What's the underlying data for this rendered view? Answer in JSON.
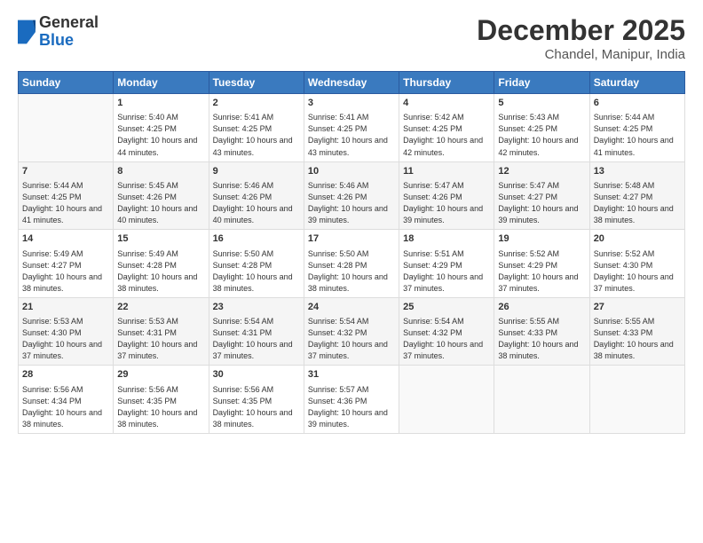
{
  "logo": {
    "general": "General",
    "blue": "Blue"
  },
  "title": "December 2025",
  "location": "Chandel, Manipur, India",
  "weekdays": [
    "Sunday",
    "Monday",
    "Tuesday",
    "Wednesday",
    "Thursday",
    "Friday",
    "Saturday"
  ],
  "weeks": [
    [
      {
        "day": "",
        "sunrise": "",
        "sunset": "",
        "daylight": ""
      },
      {
        "day": "1",
        "sunrise": "Sunrise: 5:40 AM",
        "sunset": "Sunset: 4:25 PM",
        "daylight": "Daylight: 10 hours and 44 minutes."
      },
      {
        "day": "2",
        "sunrise": "Sunrise: 5:41 AM",
        "sunset": "Sunset: 4:25 PM",
        "daylight": "Daylight: 10 hours and 43 minutes."
      },
      {
        "day": "3",
        "sunrise": "Sunrise: 5:41 AM",
        "sunset": "Sunset: 4:25 PM",
        "daylight": "Daylight: 10 hours and 43 minutes."
      },
      {
        "day": "4",
        "sunrise": "Sunrise: 5:42 AM",
        "sunset": "Sunset: 4:25 PM",
        "daylight": "Daylight: 10 hours and 42 minutes."
      },
      {
        "day": "5",
        "sunrise": "Sunrise: 5:43 AM",
        "sunset": "Sunset: 4:25 PM",
        "daylight": "Daylight: 10 hours and 42 minutes."
      },
      {
        "day": "6",
        "sunrise": "Sunrise: 5:44 AM",
        "sunset": "Sunset: 4:25 PM",
        "daylight": "Daylight: 10 hours and 41 minutes."
      }
    ],
    [
      {
        "day": "7",
        "sunrise": "Sunrise: 5:44 AM",
        "sunset": "Sunset: 4:25 PM",
        "daylight": "Daylight: 10 hours and 41 minutes."
      },
      {
        "day": "8",
        "sunrise": "Sunrise: 5:45 AM",
        "sunset": "Sunset: 4:26 PM",
        "daylight": "Daylight: 10 hours and 40 minutes."
      },
      {
        "day": "9",
        "sunrise": "Sunrise: 5:46 AM",
        "sunset": "Sunset: 4:26 PM",
        "daylight": "Daylight: 10 hours and 40 minutes."
      },
      {
        "day": "10",
        "sunrise": "Sunrise: 5:46 AM",
        "sunset": "Sunset: 4:26 PM",
        "daylight": "Daylight: 10 hours and 39 minutes."
      },
      {
        "day": "11",
        "sunrise": "Sunrise: 5:47 AM",
        "sunset": "Sunset: 4:26 PM",
        "daylight": "Daylight: 10 hours and 39 minutes."
      },
      {
        "day": "12",
        "sunrise": "Sunrise: 5:47 AM",
        "sunset": "Sunset: 4:27 PM",
        "daylight": "Daylight: 10 hours and 39 minutes."
      },
      {
        "day": "13",
        "sunrise": "Sunrise: 5:48 AM",
        "sunset": "Sunset: 4:27 PM",
        "daylight": "Daylight: 10 hours and 38 minutes."
      }
    ],
    [
      {
        "day": "14",
        "sunrise": "Sunrise: 5:49 AM",
        "sunset": "Sunset: 4:27 PM",
        "daylight": "Daylight: 10 hours and 38 minutes."
      },
      {
        "day": "15",
        "sunrise": "Sunrise: 5:49 AM",
        "sunset": "Sunset: 4:28 PM",
        "daylight": "Daylight: 10 hours and 38 minutes."
      },
      {
        "day": "16",
        "sunrise": "Sunrise: 5:50 AM",
        "sunset": "Sunset: 4:28 PM",
        "daylight": "Daylight: 10 hours and 38 minutes."
      },
      {
        "day": "17",
        "sunrise": "Sunrise: 5:50 AM",
        "sunset": "Sunset: 4:28 PM",
        "daylight": "Daylight: 10 hours and 38 minutes."
      },
      {
        "day": "18",
        "sunrise": "Sunrise: 5:51 AM",
        "sunset": "Sunset: 4:29 PM",
        "daylight": "Daylight: 10 hours and 37 minutes."
      },
      {
        "day": "19",
        "sunrise": "Sunrise: 5:52 AM",
        "sunset": "Sunset: 4:29 PM",
        "daylight": "Daylight: 10 hours and 37 minutes."
      },
      {
        "day": "20",
        "sunrise": "Sunrise: 5:52 AM",
        "sunset": "Sunset: 4:30 PM",
        "daylight": "Daylight: 10 hours and 37 minutes."
      }
    ],
    [
      {
        "day": "21",
        "sunrise": "Sunrise: 5:53 AM",
        "sunset": "Sunset: 4:30 PM",
        "daylight": "Daylight: 10 hours and 37 minutes."
      },
      {
        "day": "22",
        "sunrise": "Sunrise: 5:53 AM",
        "sunset": "Sunset: 4:31 PM",
        "daylight": "Daylight: 10 hours and 37 minutes."
      },
      {
        "day": "23",
        "sunrise": "Sunrise: 5:54 AM",
        "sunset": "Sunset: 4:31 PM",
        "daylight": "Daylight: 10 hours and 37 minutes."
      },
      {
        "day": "24",
        "sunrise": "Sunrise: 5:54 AM",
        "sunset": "Sunset: 4:32 PM",
        "daylight": "Daylight: 10 hours and 37 minutes."
      },
      {
        "day": "25",
        "sunrise": "Sunrise: 5:54 AM",
        "sunset": "Sunset: 4:32 PM",
        "daylight": "Daylight: 10 hours and 37 minutes."
      },
      {
        "day": "26",
        "sunrise": "Sunrise: 5:55 AM",
        "sunset": "Sunset: 4:33 PM",
        "daylight": "Daylight: 10 hours and 38 minutes."
      },
      {
        "day": "27",
        "sunrise": "Sunrise: 5:55 AM",
        "sunset": "Sunset: 4:33 PM",
        "daylight": "Daylight: 10 hours and 38 minutes."
      }
    ],
    [
      {
        "day": "28",
        "sunrise": "Sunrise: 5:56 AM",
        "sunset": "Sunset: 4:34 PM",
        "daylight": "Daylight: 10 hours and 38 minutes."
      },
      {
        "day": "29",
        "sunrise": "Sunrise: 5:56 AM",
        "sunset": "Sunset: 4:35 PM",
        "daylight": "Daylight: 10 hours and 38 minutes."
      },
      {
        "day": "30",
        "sunrise": "Sunrise: 5:56 AM",
        "sunset": "Sunset: 4:35 PM",
        "daylight": "Daylight: 10 hours and 38 minutes."
      },
      {
        "day": "31",
        "sunrise": "Sunrise: 5:57 AM",
        "sunset": "Sunset: 4:36 PM",
        "daylight": "Daylight: 10 hours and 39 minutes."
      },
      {
        "day": "",
        "sunrise": "",
        "sunset": "",
        "daylight": ""
      },
      {
        "day": "",
        "sunrise": "",
        "sunset": "",
        "daylight": ""
      },
      {
        "day": "",
        "sunrise": "",
        "sunset": "",
        "daylight": ""
      }
    ]
  ]
}
